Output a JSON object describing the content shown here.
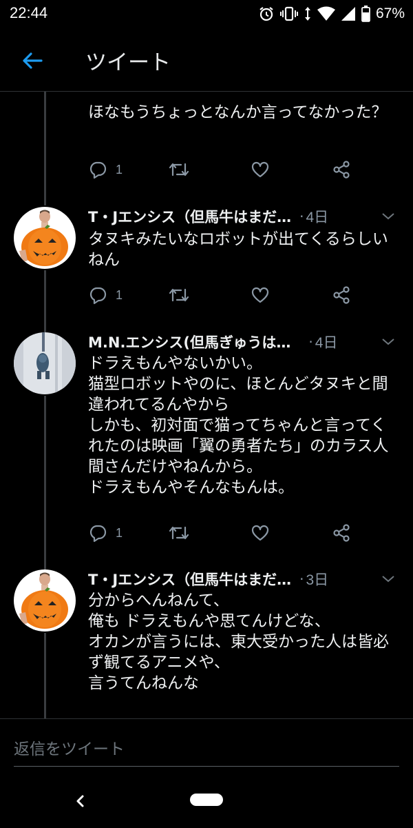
{
  "status_bar": {
    "time": "22:44",
    "battery": "67%",
    "icons": [
      "alarm-icon",
      "vibrate-icon",
      "data-arrows-icon",
      "wifi-icon",
      "signal-icon",
      "battery-icon"
    ]
  },
  "header": {
    "title": "ツイート",
    "back_icon": "arrow-left-icon",
    "accent_color": "#1d9bf0"
  },
  "tweets": [
    {
      "text": "ほなもうちょっとなんか言ってなかった？",
      "reply_count": "1"
    },
    {
      "author": "T・Jエンシス（但馬牛はまだ…",
      "dot": "·",
      "date": "4日",
      "text": "タヌキみたいなロボットが出てくるらしいねん",
      "reply_count": "1"
    },
    {
      "author": "M.N.エンシス(但馬ぎゅうは…",
      "dot": "·",
      "date": "4日",
      "text": "ドラえもんやないかい。\n猫型ロボットやのに、ほとんどタヌキと間違われてるんやから\nしかも、初対面で猫ってちゃんと言ってくれたのは映画「翼の勇者たち」のカラス人間さんだけやねんから。\nドラえもんやそんなもんは。",
      "reply_count": "1"
    },
    {
      "author": "T・Jエンシス（但馬牛はまだ…",
      "dot": "·",
      "date": "3日",
      "text": "分からへんねんて、\n俺も ドラえもんや思てんけどな、\nオカンが言うには、東大受かった人は皆必ず観てるアニメや、\n言うてんねんな"
    }
  ],
  "reply": {
    "placeholder": "返信をツイート"
  }
}
